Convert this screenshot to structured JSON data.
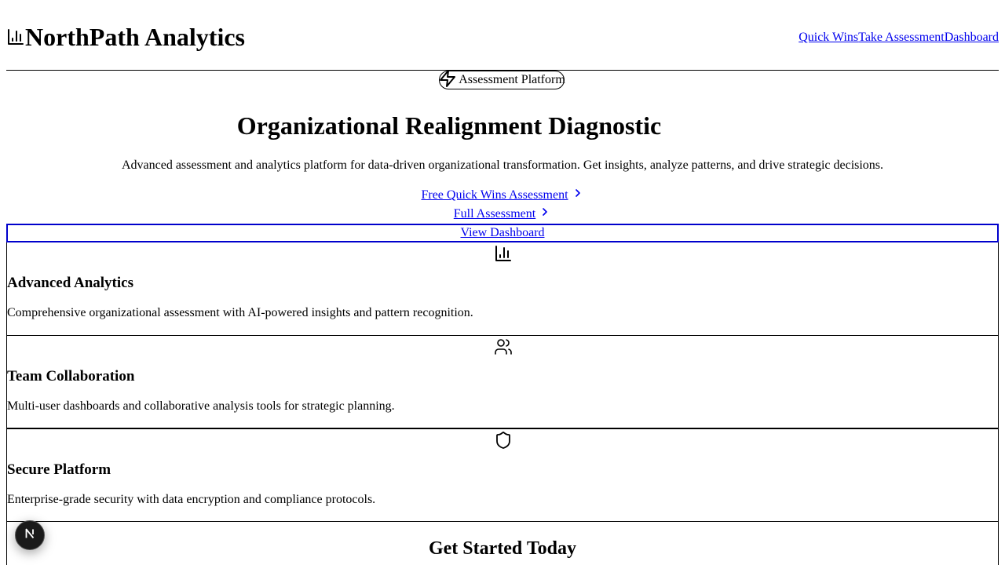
{
  "header": {
    "brand_name": "NorthPath Analytics",
    "nav": [
      "Quick Wins",
      "Take Assessment",
      "Dashboard"
    ]
  },
  "badge": {
    "label": "Assessment Platform"
  },
  "hero": {
    "title": "Organizational Realignment Diagnostic",
    "subtitle": "Advanced assessment and analytics platform for data-driven organizational transformation. Get insights, analyze patterns, and drive strategic decisions.",
    "cta_primary": "Free Quick Wins Assessment",
    "cta_secondary": "Full Assessment",
    "cta_dashboard": "View Dashboard"
  },
  "features": [
    {
      "icon": "bar-chart-icon",
      "title": "Advanced Analytics",
      "description": "Comprehensive organizational assessment with AI-powered insights and pattern recognition."
    },
    {
      "icon": "users-icon",
      "title": "Team Collaboration",
      "description": "Multi-user dashboards and collaborative analysis tools for strategic planning."
    },
    {
      "icon": "shield-icon",
      "title": "Secure Platform",
      "description": "Enterprise-grade security with data encryption and compliance protocols."
    }
  ],
  "get_started": {
    "title": "Get Started Today"
  },
  "dev_badge": {
    "icon": "nextjs-logo-icon",
    "letter": "N"
  }
}
